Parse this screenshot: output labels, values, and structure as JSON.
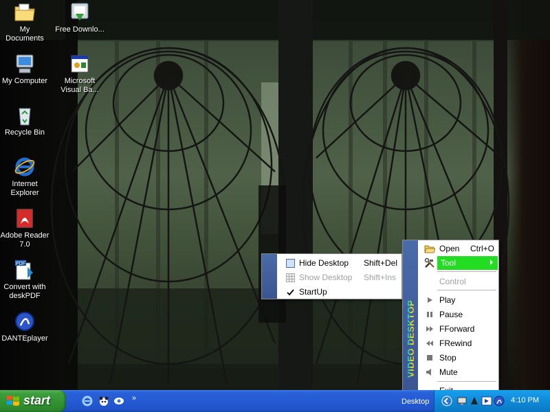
{
  "desktop": {
    "icons": [
      {
        "label": "My Documents",
        "icon": "my-documents-icon"
      },
      {
        "label": "Free Downlo...",
        "icon": "free-download-icon"
      },
      {
        "label": "My Computer",
        "icon": "my-computer-icon"
      },
      {
        "label": "Microsoft Visual Ba...",
        "icon": "visual-basic-icon"
      },
      {
        "label": "Recycle Bin",
        "icon": "recycle-bin-icon"
      },
      {
        "label": "Internet Explorer",
        "icon": "internet-explorer-icon"
      },
      {
        "label": "Adobe Reader 7.0",
        "icon": "adobe-reader-icon"
      },
      {
        "label": "Convert with deskPDF",
        "icon": "deskpdf-icon"
      },
      {
        "label": "DANTEplayer",
        "icon": "danteplayer-icon"
      }
    ]
  },
  "main_menu": {
    "sidebar_text": "VIDEO DESKTOP",
    "items": [
      {
        "label": "Open",
        "shortcut": "Ctrl+O",
        "icon": "open-folder-icon"
      },
      {
        "label": "Tool",
        "icon": "tool-icon",
        "highlighted": true,
        "submenu": true
      },
      {
        "label": "Control",
        "disabled": true
      },
      {
        "label": "Play",
        "icon": "play-icon"
      },
      {
        "label": "Pause",
        "icon": "pause-icon"
      },
      {
        "label": "FForward",
        "icon": "fast-forward-icon"
      },
      {
        "label": "FRewind",
        "icon": "rewind-icon"
      },
      {
        "label": "Stop",
        "icon": "stop-icon"
      },
      {
        "label": "Mute",
        "icon": "speaker-icon"
      },
      {
        "label": "Exit"
      }
    ]
  },
  "tool_submenu": {
    "items": [
      {
        "label": "Hide Desktop",
        "shortcut": "Shift+Del",
        "icon": "hide-desktop-icon"
      },
      {
        "label": "Show Desktop",
        "shortcut": "Shift+Ins",
        "icon": "show-desktop-icon",
        "disabled": true
      },
      {
        "label": "StartUp",
        "icon": "checkmark-icon",
        "checked": true
      }
    ]
  },
  "taskbar": {
    "start_label": "start",
    "toolbar_label": "Desktop",
    "clock": "4:10 PM",
    "chevron": "»"
  },
  "colors": {
    "highlight": "#22dd22",
    "menu_sidebar": "#4a6aa8",
    "taskbar": "#245ad4",
    "start_button": "#3c9e3c"
  }
}
